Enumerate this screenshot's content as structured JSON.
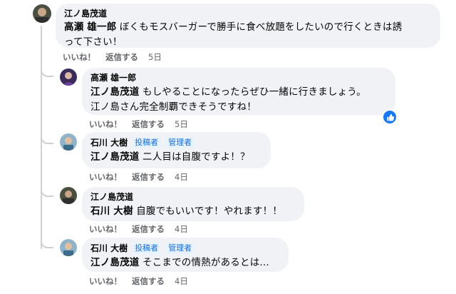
{
  "comments": [
    {
      "author": "江ノ島茂道",
      "mention": "高瀬 雄一郎",
      "text_line1": "ぼくもモスバーガーで勝手に食べ放題をしたいので行くときは誘",
      "text_line2": "って下さい！",
      "like_label": "いいね！",
      "reply_label": "返信する",
      "time": "5日"
    },
    {
      "author": "高瀬 雄一郎",
      "mention": "江ノ島茂道",
      "text_line1": "もしやることになったらぜひ一緒に行きましょう。",
      "text_line2": "江ノ島さん完全制覇できそうですね！",
      "like_label": "いいね！",
      "reply_label": "返信する",
      "time": "5日",
      "reaction": "like-icon",
      "reaction_color": "#1877f2"
    },
    {
      "author": "石川 大樹",
      "badges": [
        "投稿者",
        "管理者"
      ],
      "mention": "江ノ島茂道",
      "text": "二人目は自腹ですよ！？",
      "like_label": "いいね！",
      "reply_label": "返信する",
      "time": "4日"
    },
    {
      "author": "江ノ島茂道",
      "mention": "石川 大樹",
      "text": "自腹でもいいです！やれます！！",
      "like_label": "いいね！",
      "reply_label": "返信する",
      "time": "4日"
    },
    {
      "author": "石川 大樹",
      "badges": [
        "投稿者",
        "管理者"
      ],
      "mention": "江ノ島茂道",
      "text": "そこまでの情熱があるとは...",
      "like_label": "いいね！",
      "reply_label": "返信する",
      "time": "4日"
    }
  ]
}
